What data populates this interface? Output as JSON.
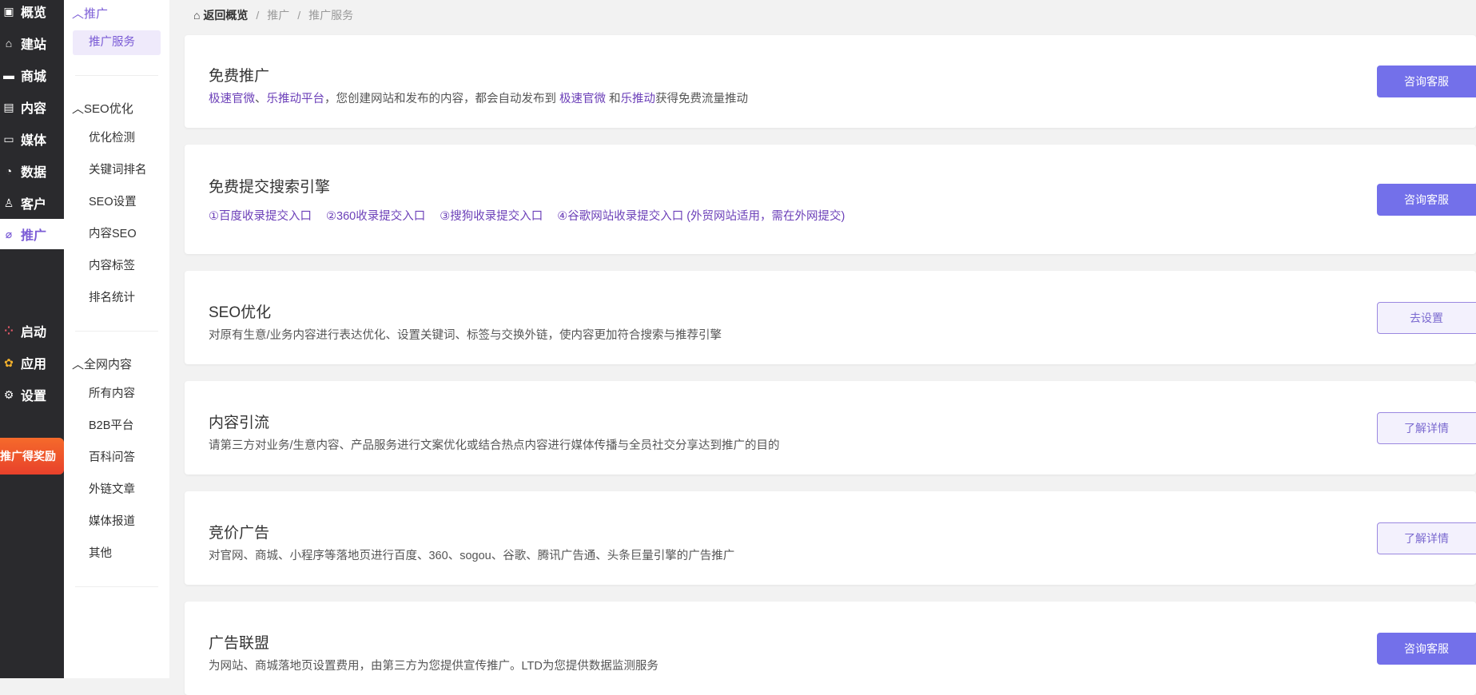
{
  "nav_main": [
    {
      "label": "概览",
      "icon": "monitor-icon"
    },
    {
      "label": "建站",
      "icon": "home-icon"
    },
    {
      "label": "商城",
      "icon": "store-icon"
    },
    {
      "label": "内容",
      "icon": "document-icon"
    },
    {
      "label": "媒体",
      "icon": "video-icon"
    },
    {
      "label": "数据",
      "icon": "pie-chart-icon"
    },
    {
      "label": "客户",
      "icon": "user-icon"
    },
    {
      "label": "推广",
      "icon": "paperclip-icon"
    },
    {
      "label": "启动",
      "icon": "launch-icon"
    },
    {
      "label": "应用",
      "icon": "apps-icon"
    },
    {
      "label": "设置",
      "icon": "gear-icon"
    }
  ],
  "promo_banner": "推广得奖励",
  "nav_sub": {
    "groups": [
      {
        "label": "推广",
        "items": [
          "推广服务"
        ]
      },
      {
        "label": "SEO优化",
        "items": [
          "优化检测",
          "关键词排名",
          "SEO设置",
          "内容SEO",
          "内容标签",
          "排名统计"
        ]
      },
      {
        "label": "全网内容",
        "items": [
          "所有内容",
          "B2B平台",
          "百科问答",
          "外链文章",
          "媒体报道",
          "其他"
        ]
      }
    ]
  },
  "breadcrumb": {
    "home": "返回概览",
    "level1": "推广",
    "level2": "推广服务"
  },
  "cards": [
    {
      "title": "免费推广",
      "desc_parts": [
        "极速官微",
        "、",
        "乐推动平台",
        "，您创建网站和发布的内容，都会自动发布到 ",
        "极速官微",
        " 和",
        "乐推动",
        "获得免费流量推动"
      ],
      "button": "咨询客服"
    },
    {
      "title": "免费提交搜索引擎",
      "links": [
        "①百度收录提交入口",
        "②360收录提交入口",
        "③搜狗收录提交入口",
        "④谷歌网站收录提交入口 (外贸网站适用，需在外网提交)"
      ],
      "button": "咨询客服"
    },
    {
      "title": "SEO优化",
      "desc": "对原有生意/业务内容进行表达优化、设置关键词、标签与交换外链，使内容更加符合搜索与推荐引擎",
      "button": "去设置"
    },
    {
      "title": "内容引流",
      "desc": "请第三方对业务/生意内容、产品服务进行文案优化或结合热点内容进行媒体传播与全员社交分享达到推广的目的",
      "button": "了解详情"
    },
    {
      "title": "竞价广告",
      "desc": "对官网、商城、小程序等落地页进行百度、360、sogou、谷歌、腾讯广告通、头条巨量引擎的广告推广",
      "button": "了解详情"
    },
    {
      "title": "广告联盟",
      "desc": "为网站、商城落地页设置费用，由第三方为您提供宣传推广。LTD为您提供数据监测服务",
      "button": "咨询客服"
    }
  ]
}
